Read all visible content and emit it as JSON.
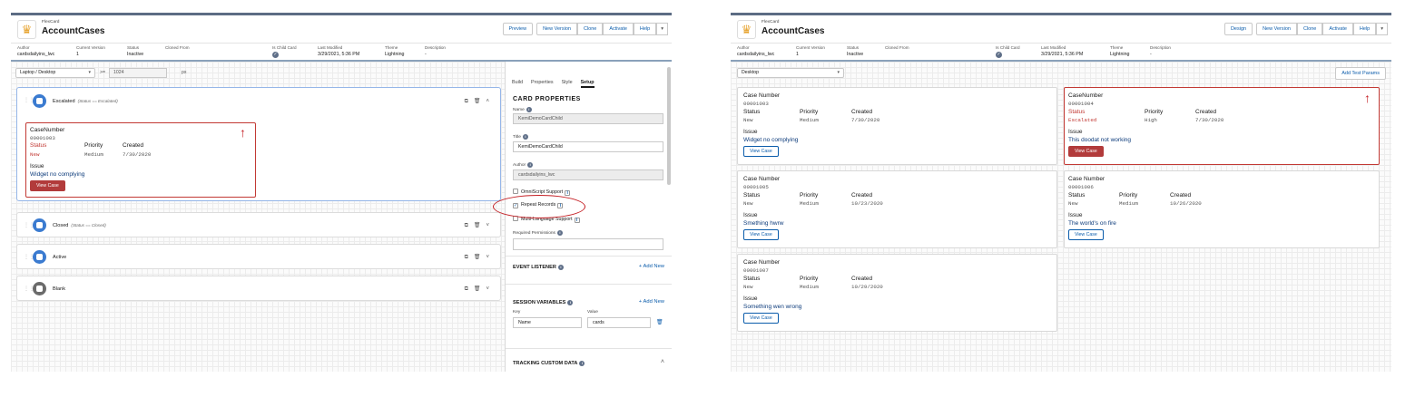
{
  "left": {
    "app_small": "FlexCard",
    "app_title": "AccountCases",
    "buttons": [
      "Preview",
      "New Version",
      "Clone",
      "Activate",
      "Help"
    ],
    "meta": {
      "author_label": "Author",
      "author": "cardsdailyins_lwc",
      "version_label": "Current Version",
      "version": "1",
      "status_label": "Status",
      "status": "Inactive",
      "cloned_label": "Cloned From",
      "child_label": "Is Child Card",
      "modified_label": "Last Modified",
      "modified": "3/29/2021, 5:36 PM",
      "theme_label": "Theme",
      "theme": "Lightning",
      "desc_label": "Description",
      "desc": "-"
    },
    "device_select": "Laptop / Desktop",
    "gte": ">=",
    "width_value": "1024",
    "px": "px",
    "states": [
      {
        "name": "Escalated",
        "cond": "(Status == Escalated)"
      },
      {
        "name": "Closed",
        "cond": "(Status == Closed)"
      },
      {
        "name": "Active",
        "cond": ""
      },
      {
        "name": "Blank",
        "cond": ""
      }
    ],
    "card": {
      "case_label": "CaseNumber",
      "case": "00001003",
      "status_label": "Status",
      "status": "New",
      "priority_label": "Priority",
      "priority": "Medium",
      "created_label": "Created",
      "created": "7/30/2020",
      "issue_label": "Issue",
      "issue": "Widget no complying",
      "button": "View Case"
    },
    "panel": {
      "tabs": [
        "Build",
        "Properties",
        "Style",
        "Setup"
      ],
      "heading": "CARD PROPERTIES",
      "name_label": "Name",
      "name": "KemiDemoCardChild",
      "title_label": "Title",
      "title": "KemiDemoCardChild",
      "author_label": "Author",
      "author": "cardsdailyins_lwc",
      "omni": "OmniScript Support",
      "repeat": "Repeat Records",
      "multi": "Multi-Language Support",
      "perms": "Required Permissions",
      "event": "EVENT LISTENER",
      "add_new": "+ Add New",
      "session": "SESSION VARIABLES",
      "key_label": "Key",
      "value_label": "Value",
      "key": "Name",
      "value": "cards",
      "tracking": "TRACKING CUSTOM DATA"
    }
  },
  "right": {
    "app_small": "FlexCard",
    "app_title": "AccountCases",
    "buttons": [
      "Design",
      "New Version",
      "Clone",
      "Activate",
      "Help"
    ],
    "meta": {
      "author_label": "Author",
      "author": "cardsdailyins_lwc",
      "version_label": "Current Version",
      "version": "1",
      "status_label": "Status",
      "status": "Inactive",
      "cloned_label": "Cloned From",
      "child_label": "Is Child Card",
      "modified_label": "Last Modified",
      "modified": "3/29/2021, 5:36 PM",
      "theme_label": "Theme",
      "theme": "Lightning",
      "desc_label": "Description",
      "desc": "-"
    },
    "device_select": "Desktop",
    "add_params": "Add Test Params",
    "labels": {
      "priority": "Priority",
      "created": "Created",
      "status": "Status",
      "issue": "Issue",
      "button": "View Case"
    },
    "cards": [
      {
        "case_label": "Case Number",
        "case": "00001003",
        "status": "New",
        "priority": "Medium",
        "created": "7/30/2020",
        "issue": "Widget no complying"
      },
      {
        "case_label": "CaseNumber",
        "case": "00001004",
        "status": "Escalated",
        "priority": "High",
        "created": "7/30/2020",
        "issue": "This doodat not working"
      },
      {
        "case_label": "Case Number",
        "case": "00001005",
        "status": "New",
        "priority": "Medium",
        "created": "10/23/2020",
        "issue": "Smething hwrw"
      },
      {
        "case_label": "Case Number",
        "case": "00001006",
        "status": "New",
        "priority": "Medium",
        "created": "10/26/2020",
        "issue": "The world's on fire"
      },
      {
        "case_label": "Case Number",
        "case": "00001007",
        "status": "New",
        "priority": "Medium",
        "created": "10/29/2020",
        "issue": "Something wen wrong"
      }
    ]
  }
}
